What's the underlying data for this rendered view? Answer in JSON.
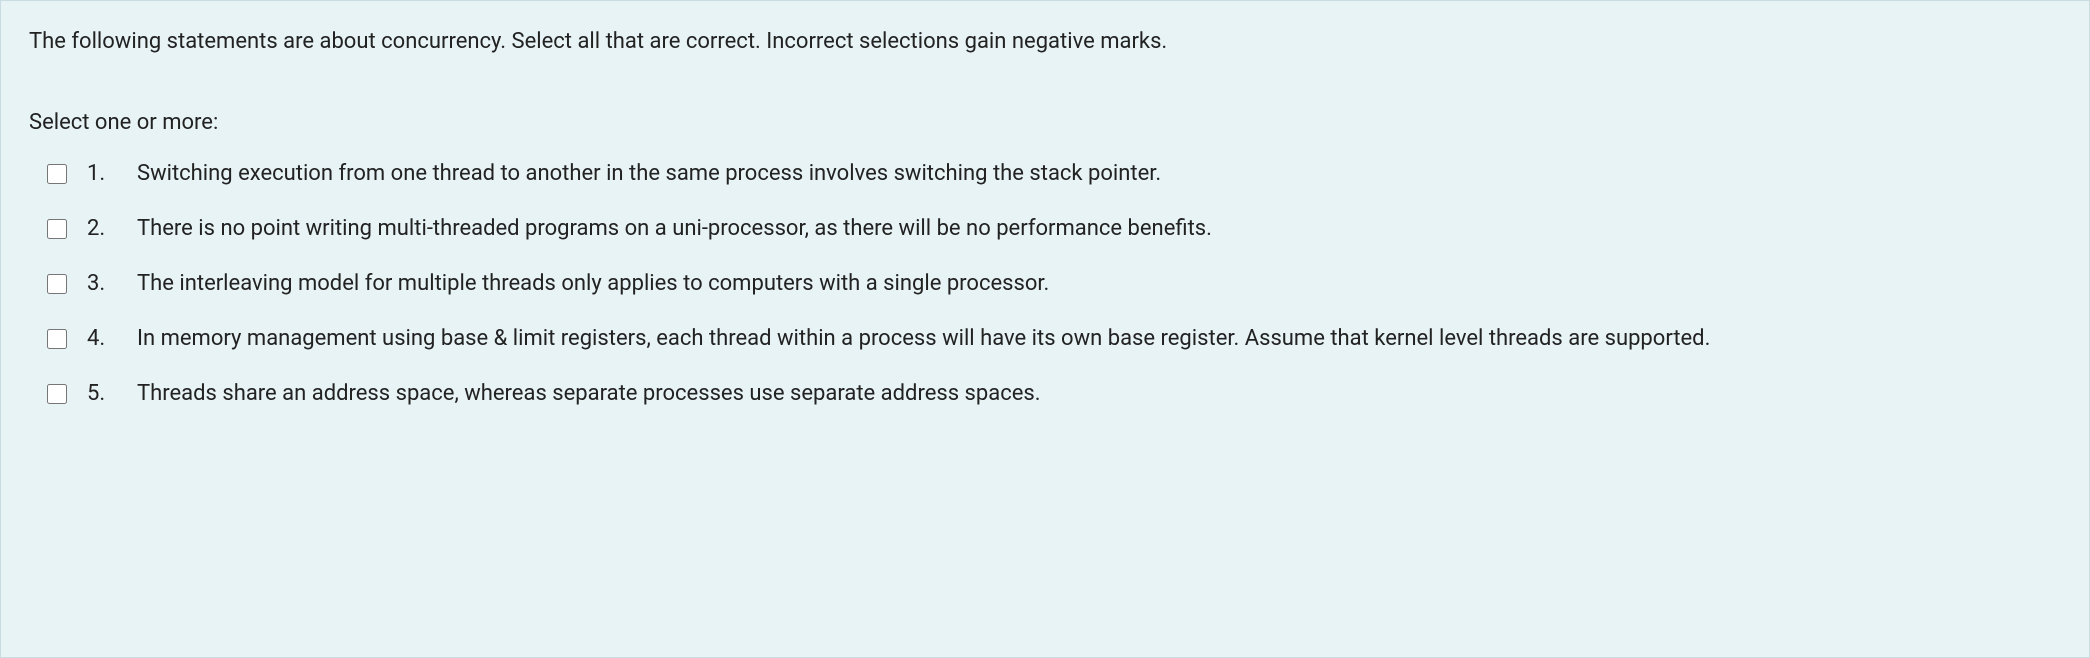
{
  "question": {
    "intro": "The following statements are about concurrency. Select all that are correct. Incorrect selections gain negative marks.",
    "prompt": "Select one or more:",
    "answers": [
      {
        "number": "1.",
        "text": "Switching execution from one thread to another in the same process involves switching the stack pointer."
      },
      {
        "number": "2.",
        "text": "There is no point writing multi-threaded programs on a uni-processor, as there will be no performance benefits."
      },
      {
        "number": "3.",
        "text": "The interleaving model for multiple threads only applies to computers with a single processor."
      },
      {
        "number": "4.",
        "text": "In memory management using base & limit registers, each thread within a process will have its own base register. Assume that kernel level threads are supported."
      },
      {
        "number": "5.",
        "text": "Threads share an address space, whereas separate processes use separate address spaces."
      }
    ]
  }
}
